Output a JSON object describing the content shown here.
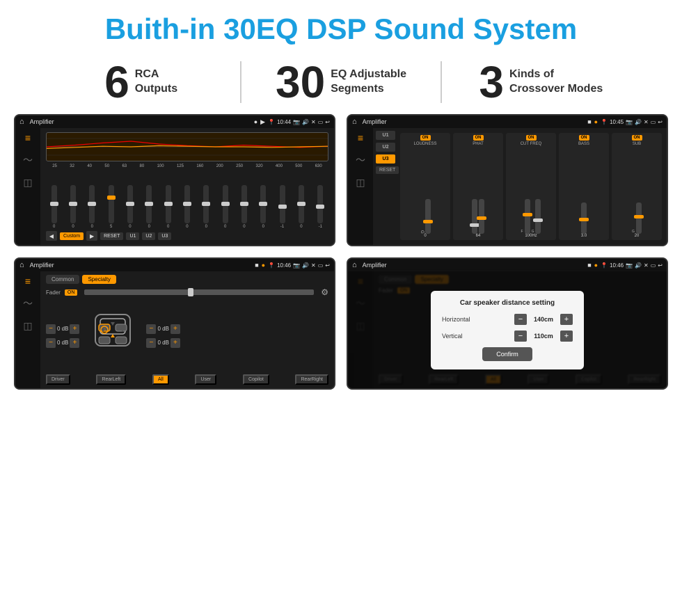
{
  "header": {
    "title": "Buith-in 30EQ DSP Sound System"
  },
  "stats": [
    {
      "number": "6",
      "label": "RCA\nOutputs"
    },
    {
      "number": "30",
      "label": "EQ Adjustable\nSegments"
    },
    {
      "number": "3",
      "label": "Kinds of\nCrossover Modes"
    }
  ],
  "screens": [
    {
      "id": "eq-screen",
      "status": {
        "app": "Amplifier",
        "time": "10:44"
      },
      "type": "equalizer"
    },
    {
      "id": "crossover-screen",
      "status": {
        "app": "Amplifier",
        "time": "10:45"
      },
      "type": "crossover"
    },
    {
      "id": "speaker-screen",
      "status": {
        "app": "Amplifier",
        "time": "10:46"
      },
      "type": "speaker"
    },
    {
      "id": "dialog-screen",
      "status": {
        "app": "Amplifier",
        "time": "10:46"
      },
      "type": "dialog"
    }
  ],
  "eq": {
    "frequencies": [
      "25",
      "32",
      "40",
      "50",
      "63",
      "80",
      "100",
      "125",
      "160",
      "200",
      "250",
      "320",
      "400",
      "500",
      "630"
    ],
    "values": [
      "0",
      "0",
      "0",
      "5",
      "0",
      "0",
      "0",
      "0",
      "0",
      "0",
      "0",
      "0",
      "-1",
      "0",
      "-1"
    ],
    "buttons": [
      "Custom",
      "RESET",
      "U1",
      "U2",
      "U3"
    ]
  },
  "crossover": {
    "presets": [
      "U1",
      "U2",
      "U3"
    ],
    "channels": [
      {
        "label": "LOUDNESS",
        "on": true
      },
      {
        "label": "PHAT",
        "on": true
      },
      {
        "label": "CUT FREQ",
        "on": true
      },
      {
        "label": "BASS",
        "on": true
      },
      {
        "label": "SUB",
        "on": true
      }
    ]
  },
  "speaker": {
    "tabs": [
      "Common",
      "Specialty"
    ],
    "fader_label": "Fader",
    "db_values": [
      "0 dB",
      "0 dB",
      "0 dB",
      "0 dB"
    ],
    "bottom_buttons": [
      "Driver",
      "RearLeft",
      "All",
      "User",
      "Copilot",
      "RearRight"
    ]
  },
  "dialog": {
    "title": "Car speaker distance setting",
    "horizontal_label": "Horizontal",
    "horizontal_value": "140cm",
    "vertical_label": "Vertical",
    "vertical_value": "110cm",
    "confirm_label": "Confirm",
    "speaker_tabs": [
      "Common",
      "Specialty"
    ]
  }
}
